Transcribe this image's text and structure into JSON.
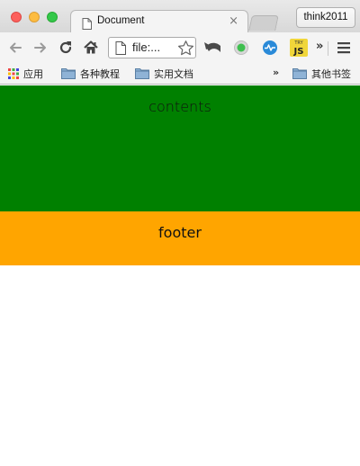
{
  "browser": {
    "tab": {
      "title": "Document",
      "close_glyph": "×"
    },
    "profile_button": "think2011",
    "omnibox": {
      "url": "file:..."
    },
    "toolbar_overflow": "»",
    "extensions": [
      "undo-extension-icon",
      "green-dot-extension-icon",
      "pulse-extension-icon",
      "js-extension-icon"
    ],
    "extension_js_label": "JS",
    "extension_js_sub": "TRY"
  },
  "bookmarks": {
    "apps_label": "应用",
    "items": [
      {
        "label": "各种教程",
        "icon": "folder-icon"
      },
      {
        "label": "实用文档",
        "icon": "folder-icon"
      }
    ],
    "overflow": "»",
    "other_bookmarks": "其他书签"
  },
  "page": {
    "contents_label": "contents",
    "footer_label": "footer",
    "contents_color": "#008000",
    "footer_color": "#ffa500"
  }
}
